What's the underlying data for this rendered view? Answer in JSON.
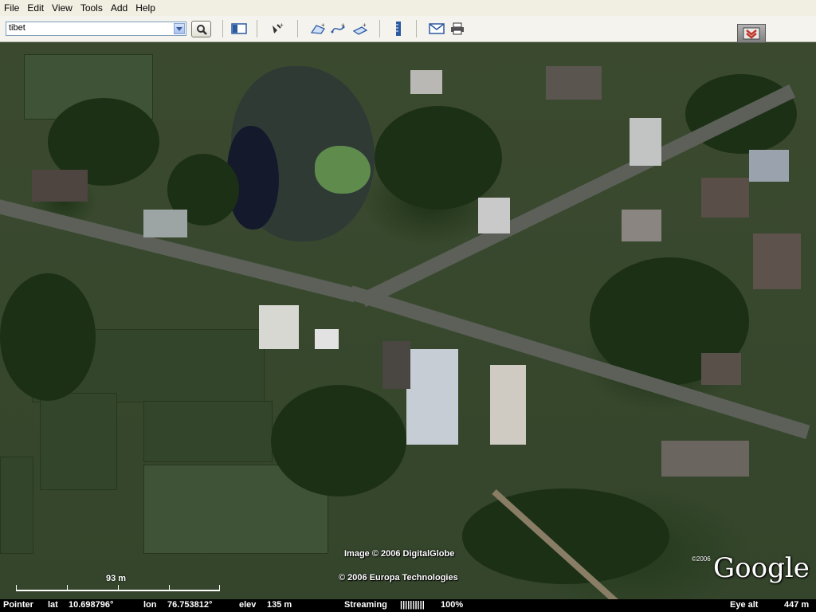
{
  "menu": {
    "items": [
      "File",
      "Edit",
      "View",
      "Tools",
      "Add",
      "Help"
    ]
  },
  "search": {
    "value": "tibet"
  },
  "toolbar": {
    "icons": [
      "search-icon",
      "sidebar-icon",
      "placemark-icon",
      "polygon-icon",
      "path-icon",
      "image-overlay-icon",
      "ruler-icon",
      "email-icon",
      "print-icon",
      "navigation-toggle-icon"
    ]
  },
  "map": {
    "attribution_line1": "Image © 2006 DigitalGlobe",
    "attribution_line2": "© 2006 Europa Technologies",
    "scale_label": "93 m",
    "logo_year": "©2006",
    "logo_text": "Google"
  },
  "status": {
    "pointer_label": "Pointer",
    "lat_label": "lat",
    "lat_value": "10.698796°",
    "lon_label": "lon",
    "lon_value": "76.753812°",
    "elev_label": "elev",
    "elev_value": "135 m",
    "streaming_label": "Streaming",
    "streaming_bars": "||||||||||",
    "streaming_percent": "100%",
    "eye_alt_label": "Eye alt",
    "eye_alt_value": "447 m"
  },
  "colors": {
    "menubar_bg": "#f1efe2",
    "statusbar_bg": "#000000",
    "map_base": "#3b4a2f"
  }
}
